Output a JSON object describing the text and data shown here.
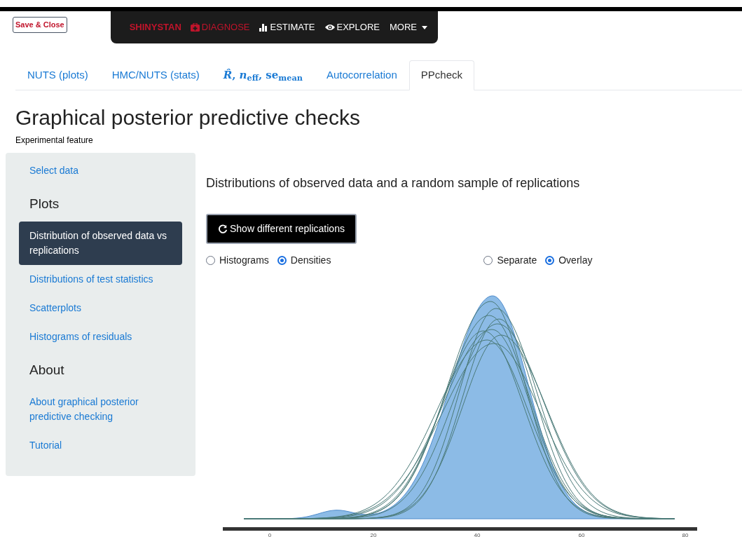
{
  "save_button": "Save & Close",
  "navbar": {
    "brand": "SHINYSTAN",
    "items": [
      {
        "label": "DIAGNOSE",
        "kind": "medkit",
        "selected": true
      },
      {
        "label": "ESTIMATE",
        "kind": "bars",
        "selected": false
      },
      {
        "label": "EXPLORE",
        "kind": "eye",
        "selected": false
      },
      {
        "label": "MORE",
        "kind": "dropdown",
        "selected": false
      }
    ]
  },
  "tabs": [
    {
      "label": "NUTS (plots)",
      "selected": false,
      "kind": "text"
    },
    {
      "label": "HMC/NUTS (stats)",
      "selected": false,
      "kind": "text"
    },
    {
      "label": "*R̂*, *n*$_{eff}$, se$_{mean}$",
      "selected": false,
      "kind": "math"
    },
    {
      "label": "Autocorrelation",
      "selected": false,
      "kind": "text"
    },
    {
      "label": "PPcheck",
      "selected": true,
      "kind": "text"
    }
  ],
  "title": "Graphical posterior predictive checks",
  "subtitle": "Experimental feature",
  "sidebar": {
    "items": [
      {
        "kind": "link",
        "label": "Select data",
        "selected": false
      },
      {
        "kind": "heading",
        "label": "Plots"
      },
      {
        "kind": "link",
        "label": "Distribution of observed data vs replications",
        "selected": true
      },
      {
        "kind": "link",
        "label": "Distributions of test statistics",
        "selected": false
      },
      {
        "kind": "link",
        "label": "Scatterplots",
        "selected": false
      },
      {
        "kind": "link",
        "label": "Histograms of residuals",
        "selected": false
      },
      {
        "kind": "heading",
        "label": "About"
      },
      {
        "kind": "link",
        "label": "About graphical posterior predictive checking",
        "selected": false
      },
      {
        "kind": "link",
        "label": "Tutorial",
        "selected": false
      }
    ]
  },
  "main": {
    "heading": "Distributions of observed data and a random sample of replications",
    "button": "Show different replications",
    "radio_groups": [
      [
        {
          "label": "Histograms",
          "selected": false
        },
        {
          "label": "Densities",
          "selected": true
        }
      ],
      [
        {
          "label": "Separate",
          "selected": false
        },
        {
          "label": "Overlay",
          "selected": true
        }
      ]
    ],
    "plot": {
      "kind": "picture",
      "x_tick_labels": [
        "0",
        "20",
        "40",
        "60",
        "80"
      ]
    }
  }
}
